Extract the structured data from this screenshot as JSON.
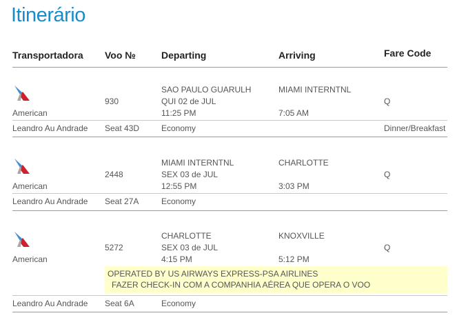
{
  "page": {
    "title": "Itinerário"
  },
  "columns": {
    "carrier": "Transportadora",
    "flight": "Voo №",
    "departing": "Departing",
    "arriving": "Arriving",
    "fare_code": "Fare Code"
  },
  "flights": [
    {
      "airline": "American",
      "logo_icon": "american-airlines-logo-icon",
      "flight_number": "930",
      "departing": {
        "airport": "SAO PAULO GUARULH",
        "date": "QUI 02 de JUL",
        "time": "11:25 PM"
      },
      "arriving": {
        "airport": "MIAMI INTERNTNL",
        "time": "7:05 AM"
      },
      "fare_code": "Q",
      "passenger": {
        "name": "Leandro Au Andrade",
        "seat": "Seat 43D",
        "cabin": "Economy",
        "meal": "Dinner/Breakfast"
      }
    },
    {
      "airline": "American",
      "logo_icon": "american-airlines-logo-icon",
      "flight_number": "2448",
      "departing": {
        "airport": "MIAMI INTERNTNL",
        "date": "SEX 03 de JUL",
        "time": "12:55 PM"
      },
      "arriving": {
        "airport": "CHARLOTTE",
        "time": "3:03 PM"
      },
      "fare_code": "Q",
      "passenger": {
        "name": "Leandro Au Andrade",
        "seat": "Seat 27A",
        "cabin": "Economy"
      }
    },
    {
      "airline": "American",
      "logo_icon": "american-airlines-logo-icon",
      "flight_number": "5272",
      "departing": {
        "airport": "CHARLOTTE",
        "date": "SEX 03 de JUL",
        "time": "4:15 PM"
      },
      "arriving": {
        "airport": "KNOXVILLE",
        "time": "5:12 PM"
      },
      "fare_code": "Q",
      "operated_note": {
        "line1": "OPERATED BY US AIRWAYS EXPRESS-PSA AIRLINES",
        "line2": "FAZER CHECK-IN COM A COMPANHIA AÉREA QUE OPERA O VOO"
      },
      "passenger": {
        "name": "Leandro Au Andrade",
        "seat": "Seat 6A",
        "cabin": "Economy"
      }
    }
  ],
  "colors": {
    "title": "#1a8bc9",
    "note_background": "#ffffcc",
    "logo_red": "#d0202e",
    "logo_blue": "#3b8fd6"
  }
}
